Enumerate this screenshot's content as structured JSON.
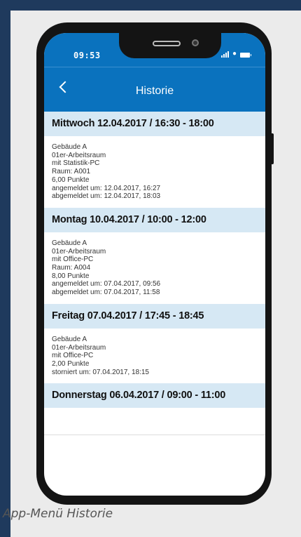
{
  "caption": "App-Menü Historie",
  "status_bar": {
    "time": "09:53",
    "icons": [
      "signal-icon",
      "wifi-icon",
      "battery-icon"
    ]
  },
  "nav": {
    "title": "Historie",
    "back_icon": "chevron-left-icon"
  },
  "colors": {
    "brand_blue": "#0a72be",
    "header_bg": "#d6e8f4",
    "page_bg": "#1f3a5d"
  },
  "entries": [
    {
      "header": "Mittwoch 12.04.2017 / 16:30 - 18:00",
      "lines": [
        "Gebäude A",
        "01er-Arbeitsraum",
        "mit Statistik-PC",
        "Raum: A001",
        "6,00 Punkte",
        "angemeldet um: 12.04.2017, 16:27",
        "abgemeldet um: 12.04.2017, 18:03"
      ]
    },
    {
      "header": "Montag 10.04.2017 / 10:00 - 12:00",
      "lines": [
        "Gebäude A",
        "01er-Arbeitsraum",
        "mit Office-PC",
        "Raum: A004",
        "8,00 Punkte",
        "angemeldet um: 07.04.2017, 09:56",
        "abgemeldet um: 07.04.2017, 11:58"
      ]
    },
    {
      "header": "Freitag 07.04.2017 / 17:45 - 18:45",
      "lines": [
        "Gebäude A",
        "01er-Arbeitsraum",
        "mit Office-PC",
        "2,00 Punkte",
        "storniert um: 07.04.2017, 18:15"
      ]
    },
    {
      "header": "Donnerstag 06.04.2017 / 09:00 - 11:00",
      "lines": []
    }
  ]
}
